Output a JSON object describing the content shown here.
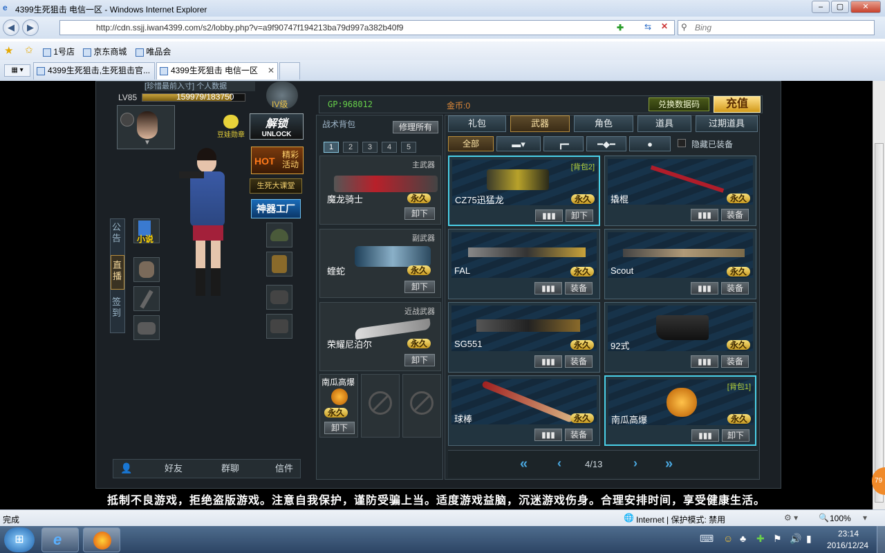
{
  "browser": {
    "window_title": "4399生死狙击 电信一区 - Windows Internet Explorer",
    "url": "http://cdn.ssjj.iwan4399.com/s2/lobby.php?v=a9f90747f194213ba79d997a382b40f9",
    "search_placeholder": "Bing",
    "favorites": [
      "1号店",
      "京东商城",
      "唯品会"
    ],
    "tabs": [
      "4399生死狙击,生死狙击官...",
      "4399生死狙击 电信一区"
    ],
    "status_left": "完成",
    "status_zone": "Internet | 保护模式: 禁用",
    "zoom": "100%"
  },
  "game": {
    "header_cut_left": "[珍惜最前入寸]",
    "header_cut_mid": "个人数据",
    "level": "LV85",
    "exp": "159979/183750",
    "rank": "IV级",
    "gp": "GP:968012",
    "coins": "金币:0",
    "redeem_btn": "兑换数据码",
    "recharge_btn": "充值",
    "doll_badge": "豆娃勋章",
    "unlock_cn": "解锁",
    "unlock_en": "UNLOCK",
    "hot_label": "HOT",
    "hot_event": "精彩活动",
    "class_btn": "生死大课堂",
    "factory_btn": "神器工厂",
    "novel_label": "小说",
    "left_tabs": [
      "公告",
      "直播",
      "签到"
    ],
    "bottom_bar": [
      "好友",
      "群聊",
      "信件"
    ],
    "backpack": {
      "title": "战术背包",
      "repair_all": "修理所有",
      "pages": [
        "1",
        "2",
        "3",
        "4",
        "5"
      ],
      "slots": [
        {
          "category": "主武器",
          "name": "魔龙骑士",
          "perm": "永久",
          "action": "卸下"
        },
        {
          "category": "副武器",
          "name": "蝰蛇",
          "perm": "永久",
          "action": "卸下"
        },
        {
          "category": "近战武器",
          "name": "荣耀尼泊尔",
          "perm": "永久",
          "action": "卸下"
        }
      ],
      "grenade": {
        "name": "南瓜高爆",
        "perm": "永久",
        "action": "卸下"
      }
    },
    "shop_tabs": [
      "礼包",
      "武器",
      "角色",
      "道具",
      "过期道具"
    ],
    "filters": {
      "all": "全部",
      "hide_equipped": "隐藏已装备"
    },
    "weapons": [
      {
        "name": "CZ75迅猛龙",
        "perm": "永久",
        "action": "卸下",
        "bag": "[背包2]",
        "selected": true
      },
      {
        "name": "撬棍",
        "perm": "永久",
        "action": "装备",
        "bag": "",
        "selected": false
      },
      {
        "name": "FAL",
        "perm": "永久",
        "action": "装备",
        "bag": "",
        "selected": false
      },
      {
        "name": "Scout",
        "perm": "永久",
        "action": "装备",
        "bag": "",
        "selected": false
      },
      {
        "name": "SG551",
        "perm": "永久",
        "action": "装备",
        "bag": "",
        "selected": false
      },
      {
        "name": "92式",
        "perm": "永久",
        "action": "装备",
        "bag": "",
        "selected": false
      },
      {
        "name": "球棒",
        "perm": "永久",
        "action": "装备",
        "bag": "",
        "selected": false
      },
      {
        "name": "南瓜高爆",
        "perm": "永久",
        "action": "卸下",
        "bag": "[背包1]",
        "selected": true
      }
    ],
    "pagination": "4/13",
    "notice": "抵制不良游戏，拒绝盗版游戏。注意自我保护，谨防受骗上当。适度游戏益脑，沉迷游戏伤身。合理安排时间，享受健康生活。",
    "side_badge": "79"
  },
  "taskbar": {
    "time": "23:14",
    "date": "2016/12/24"
  },
  "colors": {
    "accent_cyan": "#4ad0e8",
    "gold": "#e8c24a",
    "perm_yellow": "#f7e07a"
  }
}
